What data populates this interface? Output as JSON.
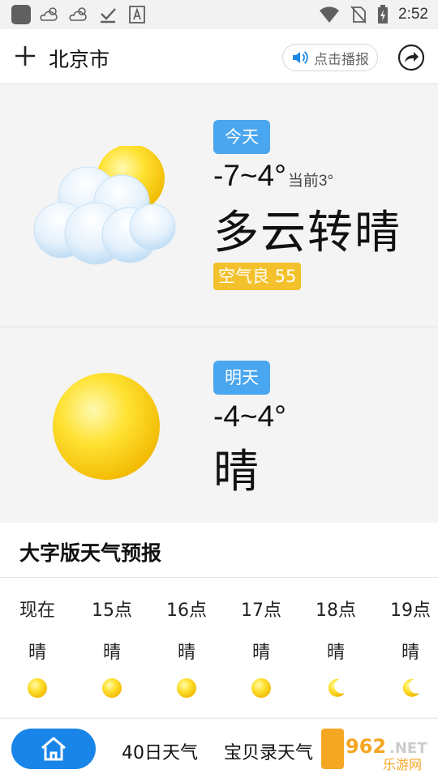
{
  "status_bar": {
    "time": "2:52",
    "left_icons": [
      "app-icon",
      "cloud-sun-icon",
      "cloud-sun-icon",
      "download-done-icon",
      "font-icon"
    ],
    "right_icons": [
      "wifi-icon",
      "no-sim-icon",
      "battery-charging-icon"
    ]
  },
  "header": {
    "add_icon": "plus-icon",
    "city": "北京市",
    "broadcast_label": "点击播报",
    "share_icon": "share-icon"
  },
  "today": {
    "tag": "今天",
    "temp_range": "-7~4°",
    "current": "当前3°",
    "condition": "多云转晴",
    "aqi": "空气良 55",
    "icon": "cloud-sun-icon"
  },
  "tomorrow": {
    "tag": "明天",
    "temp_range": "-4~4°",
    "condition": "晴",
    "icon": "sun-icon"
  },
  "forecast": {
    "title": "大字版天气预报",
    "hours": [
      {
        "time": "现在",
        "condition": "晴",
        "icon": "sun-icon"
      },
      {
        "time": "15点",
        "condition": "晴",
        "icon": "sun-icon"
      },
      {
        "time": "16点",
        "condition": "晴",
        "icon": "sun-icon"
      },
      {
        "time": "17点",
        "condition": "晴",
        "icon": "sun-icon"
      },
      {
        "time": "18点",
        "condition": "晴",
        "icon": "moon-icon"
      },
      {
        "time": "19点",
        "condition": "晴",
        "icon": "moon-icon"
      }
    ]
  },
  "bottom_nav": {
    "home_icon": "home-icon",
    "links": [
      "40日天气",
      "宝贝录天气"
    ]
  },
  "watermark": {
    "text": "962.NET",
    "subtext": "乐游网"
  },
  "colors": {
    "accent_blue": "#4aa6ee",
    "home_button": "#1985e8",
    "aqi_yellow": "#f3c12b",
    "sun_yellow": "#ffd21e"
  }
}
